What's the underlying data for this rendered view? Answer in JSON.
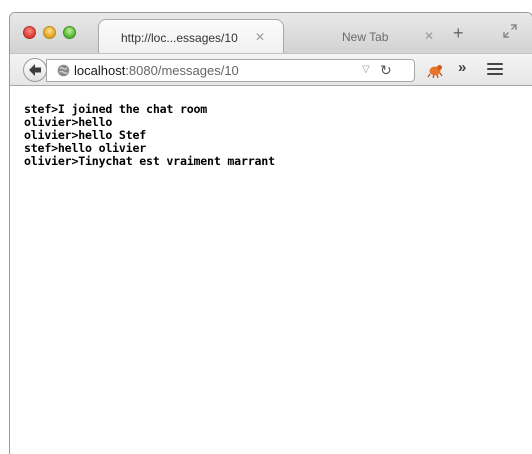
{
  "window": {
    "tabs": [
      {
        "title": "http://loc...essages/10",
        "active": true
      },
      {
        "title": "New Tab",
        "active": false
      }
    ],
    "new_tab_symbol": "+"
  },
  "navbar": {
    "url_host": "localhost",
    "url_rest": ":8080/messages/10",
    "icons": [
      "back-arrow-icon",
      "globe-icon",
      "dropdown-icon",
      "reload-icon",
      "addon-icon",
      "overflow-icon",
      "menu-icon"
    ]
  },
  "messages": [
    "stef>I joined the chat room",
    "olivier>hello",
    "olivier>hello Stef",
    "stef>hello olivier",
    "olivier>Tinychat est vraiment marrant"
  ],
  "colors": {
    "close": "#e0443e",
    "minimize": "#e6a92b",
    "maximize": "#5dbd3b",
    "addon": "#e8742a"
  }
}
